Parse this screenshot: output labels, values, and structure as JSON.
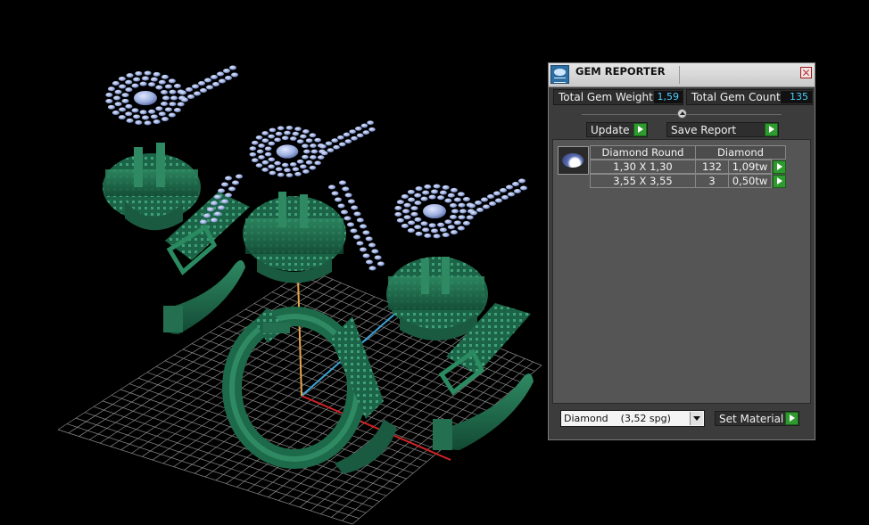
{
  "panel": {
    "title": "GEM REPORTER",
    "total_weight_label": "Total Gem Weight",
    "total_weight_value": "1,59",
    "total_count_label": "Total Gem Count",
    "total_count_value": "135",
    "update_label": "Update",
    "save_report_label": "Save Report",
    "table": {
      "shape": "Diamond Round",
      "material": "Diamond",
      "rows": [
        {
          "size": "1,30 X 1,30",
          "count": "132",
          "weight": "1,09tw"
        },
        {
          "size": "3,55 X 3,55",
          "count": "3",
          "weight": "0,50tw"
        }
      ]
    },
    "material_select_value": "Diamond    (3,52 spg)",
    "set_material_label": "Set Material"
  },
  "colors": {
    "metal": "#1f6a4c",
    "gem": "#a9b9e6",
    "grid": "#7f7f7f",
    "accent_value": "#4fd0ff",
    "play_button": "#2f9a2f"
  }
}
